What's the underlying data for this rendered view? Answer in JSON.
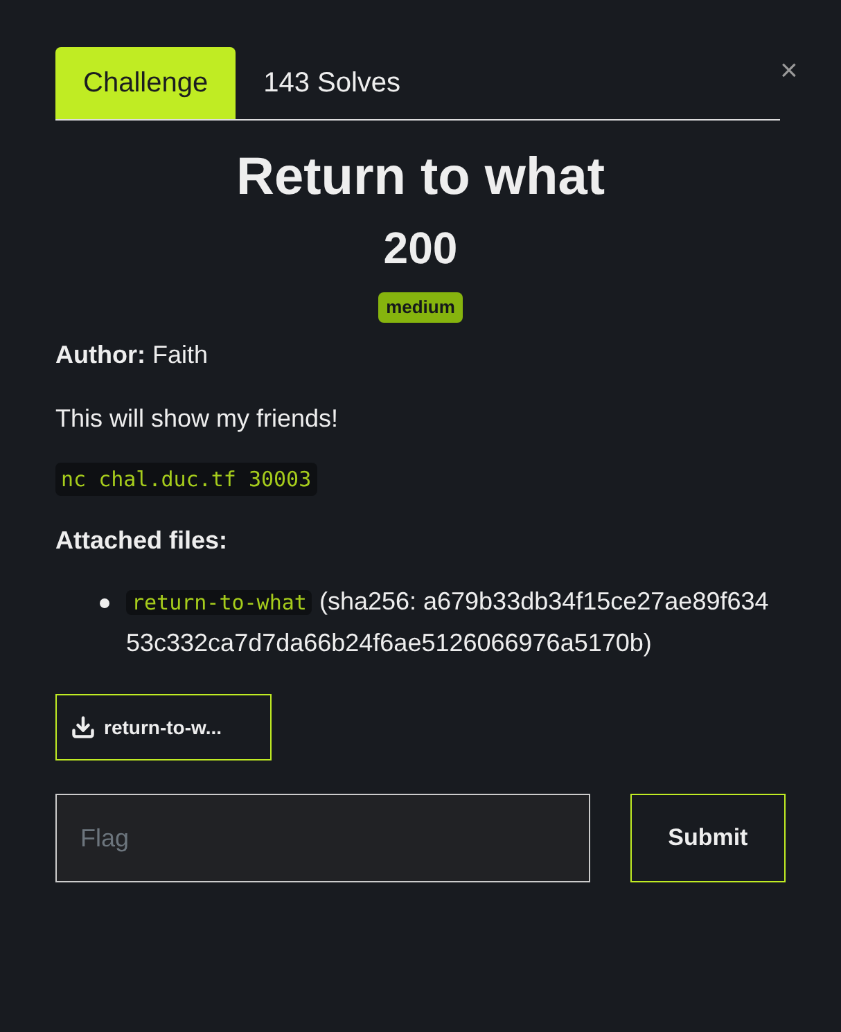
{
  "tabs": [
    {
      "label": "Challenge",
      "selected": true
    },
    {
      "label": "143 Solves",
      "selected": false
    }
  ],
  "close": "×",
  "challenge": {
    "name": "Return to what",
    "points": "200",
    "difficulty": "medium"
  },
  "author": {
    "label": "Author:",
    "value": "Faith"
  },
  "description": "This will show my friends!",
  "connection": "nc chal.duc.tf 30003",
  "attachments_label": "Attached files:",
  "files": [
    {
      "name": "return-to-what",
      "hash": "(sha256: a679b33db34f15ce27ae89f63453c332ca7d7da66b24f6ae5126066976a5170b)"
    }
  ],
  "download_button": "return-to-w...",
  "flag": {
    "placeholder": "Flag"
  },
  "submit": "Submit"
}
